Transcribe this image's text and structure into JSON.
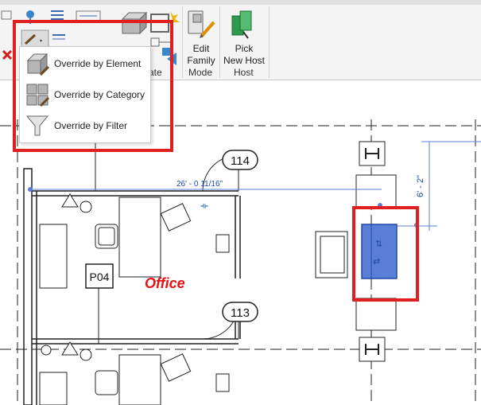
{
  "ribbon": {
    "edit_family_line1": "Edit",
    "edit_family_line2": "Family",
    "pick_new_host_line1": "Pick",
    "pick_new_host_line2": "New Host",
    "group_partial": "ate",
    "group_mode": "Mode",
    "group_host": "Host"
  },
  "override_menu": {
    "items": [
      {
        "label": "Override by Element",
        "icon": "override-element-icon"
      },
      {
        "label": "Override by Category",
        "icon": "override-category-icon"
      },
      {
        "label": "Override by Filter",
        "icon": "override-filter-icon"
      }
    ]
  },
  "drawing": {
    "room_number_top": "114",
    "room_number_bottom": "113",
    "dimension_horizontal": "26' - 0 11/16\"",
    "dimension_vertical": "6' - 2\"",
    "tag_label": "P04",
    "room_name": "Office"
  },
  "colors": {
    "accent_red": "#e02020",
    "selection_blue": "#5b7fd6",
    "dimension_blue": "#1f4aa8",
    "room_name_red": "#e81010"
  }
}
